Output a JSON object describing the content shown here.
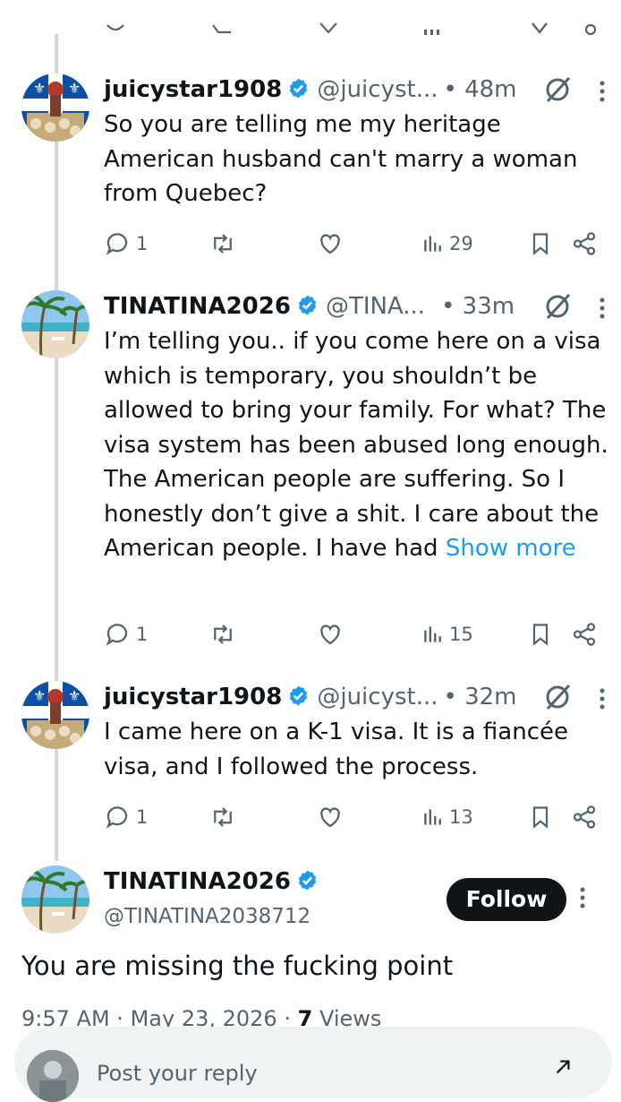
{
  "posts": [
    {
      "name": "juicystar1908",
      "handle": "@juicyst...",
      "time": "• 48m",
      "text": "So you are telling me my heritage American husband can't marry a woman from Quebec?",
      "show_more": "",
      "replies": "1",
      "reposts": "",
      "likes": "",
      "views": "29",
      "avatar": "quebec-flag-avatar"
    },
    {
      "name": "TINATINA2026",
      "handle": "@TINA...",
      "time": "• 33m",
      "text": "I’m telling you.. if you come here on a visa which is temporary, you shouldn’t be allowed to bring your family. For what? The visa system has been abused long enough. The American people are suffering. So I honestly don’t give a shit. I care about the American people. I have had ",
      "show_more": "Show more",
      "replies": "1",
      "reposts": "",
      "likes": "",
      "views": "15",
      "avatar": "beach-palm-avatar"
    },
    {
      "name": "juicystar1908",
      "handle": "@juicyst...",
      "time": "• 32m",
      "text": "I came here on a K-1 visa. It is a fiancée visa, and I followed the process.",
      "show_more": "",
      "replies": "1",
      "reposts": "",
      "likes": "",
      "views": "13",
      "avatar": "quebec-flag-avatar"
    }
  ],
  "main_post": {
    "name": "TINATINA2026",
    "handle": "@TINATINA2038712",
    "follow_label": "Follow",
    "text": "You are missing the fucking point",
    "time": "9:57 AM",
    "date": "May 23, 2026",
    "views_count": "7",
    "views_label": "Views",
    "separator": "·"
  },
  "reply_box": {
    "placeholder": "Post your reply"
  },
  "colors": {
    "verified": "#1d9bf0",
    "link": "#1d9bf0",
    "muted": "#536471",
    "text": "#0f1419",
    "thread_line": "#cfd9de"
  }
}
